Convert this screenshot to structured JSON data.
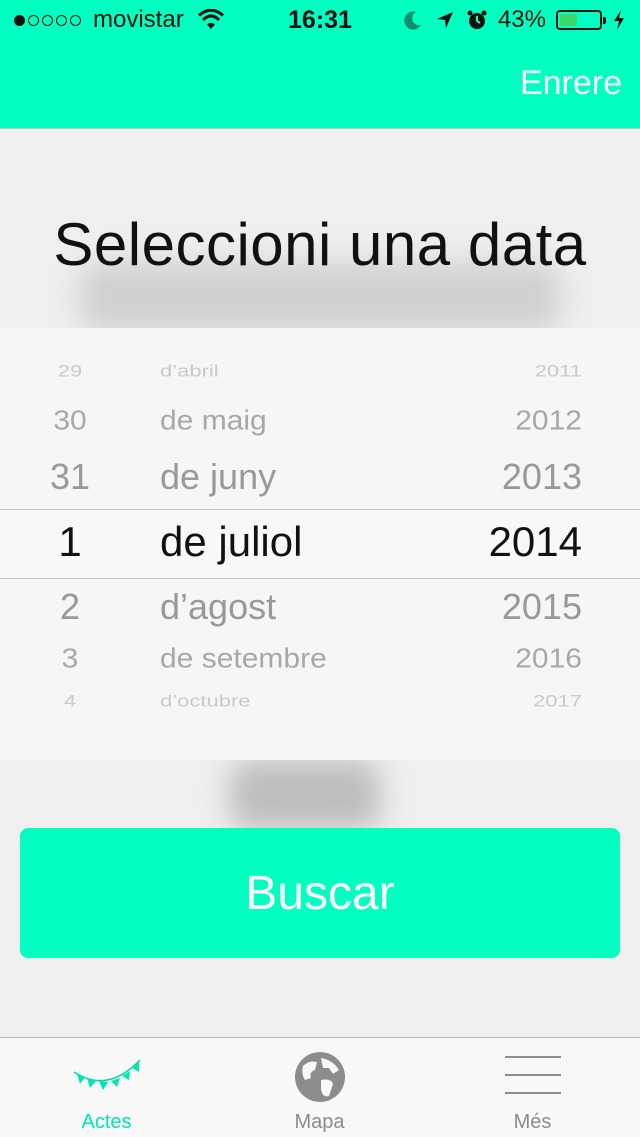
{
  "status_bar": {
    "carrier": "movistar",
    "signal_dots": [
      true,
      false,
      false,
      false,
      false
    ],
    "time": "16:31",
    "battery_percent": "43%",
    "battery_level": 0.43
  },
  "header": {
    "back_label": "Enrere",
    "accent_color": "#00ffc0"
  },
  "title": "Seleccioni una data",
  "picker": {
    "days": [
      "29",
      "30",
      "31",
      "1",
      "2",
      "3",
      "4"
    ],
    "months": [
      "d’abril",
      "de maig",
      "de juny",
      "de juliol",
      "d’agost",
      "de setembre",
      "d’octubre"
    ],
    "years": [
      "2011",
      "2012",
      "2013",
      "2014",
      "2015",
      "2016",
      "2017"
    ],
    "selected": {
      "day": "1",
      "month": "de juliol",
      "year": "2014"
    }
  },
  "search_button": {
    "label": "Buscar"
  },
  "tab_bar": {
    "tabs": [
      {
        "label": "Actes",
        "icon": "bunting-icon",
        "active": true
      },
      {
        "label": "Mapa",
        "icon": "globe-icon",
        "active": false
      },
      {
        "label": "Més",
        "icon": "menu-lines-icon",
        "active": false
      }
    ]
  }
}
